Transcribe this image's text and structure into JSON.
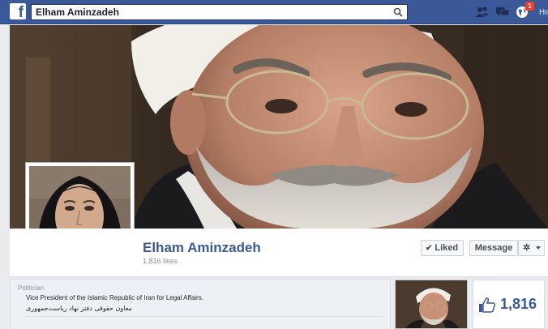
{
  "topbar": {
    "logo": "f",
    "search_value": "Elham Aminzadeh",
    "notification_count": "1",
    "home_link": "He"
  },
  "page": {
    "name": "Elham Aminzadeh",
    "likes_text": "1,816 likes",
    "liked_label": "Liked",
    "message_label": "Message"
  },
  "about": {
    "category": "Politician",
    "description": "Vice President of the Islamic Republic of Iran for Legal Affairs.",
    "description_fa": "معاون حقوقی دفتر نهاد ریاست‌جمهوری"
  },
  "likes_box": {
    "count": "1,816"
  },
  "colors": {
    "brand": "#3b5998",
    "badge": "#f03d25"
  }
}
